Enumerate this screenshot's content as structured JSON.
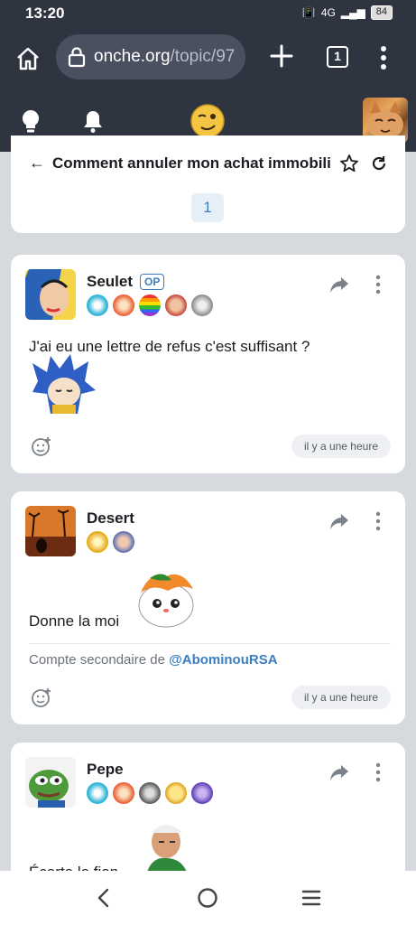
{
  "status": {
    "time": "13:20",
    "network": "4G",
    "battery": "84"
  },
  "browser": {
    "url_host": "onche.org",
    "url_path": "/topic/97",
    "tab_count": "1"
  },
  "topic": {
    "title": "Comment annuler mon achat immobili",
    "page": "1"
  },
  "posts": [
    {
      "author": "Seulet",
      "op_label": "OP",
      "text": "J'ai eu une lettre de refus c'est suffisant ?",
      "time": "il y a une heure"
    },
    {
      "author": "Desert",
      "text": "Donne la moi",
      "secondary_prefix": "Compte secondaire de",
      "secondary_user": "@AbominouRSA",
      "time": "il y a une heure"
    },
    {
      "author": "Pepe",
      "text": "Écarte le fion"
    }
  ],
  "icons": {
    "home": "home-icon",
    "lock": "lock-icon",
    "plus": "plus-icon",
    "tabs": "tabs-icon",
    "menu": "menu-icon",
    "bulb": "lightbulb-icon",
    "bell": "bell-icon",
    "share": "share-icon",
    "react": "add-reaction-icon"
  },
  "colors": {
    "chrome": "#2f3441",
    "background": "#d6d9de",
    "accent": "#3a7ec4"
  }
}
